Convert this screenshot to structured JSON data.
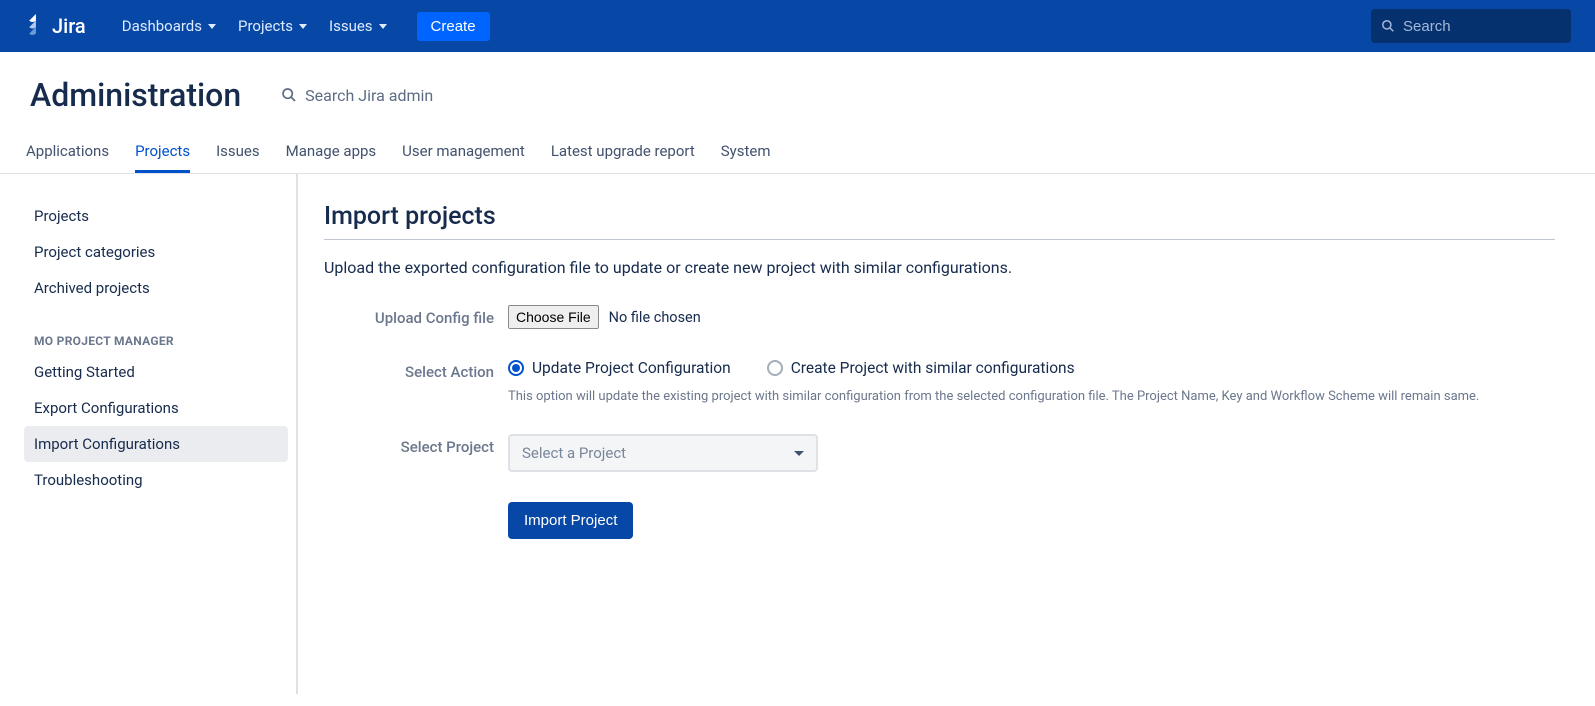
{
  "topnav": {
    "brand": "Jira",
    "items": [
      "Dashboards",
      "Projects",
      "Issues"
    ],
    "create_label": "Create",
    "search_placeholder": "Search"
  },
  "admin": {
    "title": "Administration",
    "search_placeholder": "Search Jira admin"
  },
  "tabs": [
    "Applications",
    "Projects",
    "Issues",
    "Manage apps",
    "User management",
    "Latest upgrade report",
    "System"
  ],
  "tabs_active_index": 1,
  "sidebar": {
    "group1": [
      "Projects",
      "Project categories",
      "Archived projects"
    ],
    "heading": "MO PROJECT MANAGER",
    "group2": [
      "Getting Started",
      "Export Configurations",
      "Import Configurations",
      "Troubleshooting"
    ],
    "group2_selected_index": 2
  },
  "main": {
    "title": "Import projects",
    "desc": "Upload the exported configuration file to update or create new project with similar configurations.",
    "upload_label": "Upload Config file",
    "choose_file_btn": "Choose File",
    "no_file": "No file chosen",
    "action_label": "Select Action",
    "radio1": "Update Project Configuration",
    "radio2": "Create Project with similar configurations",
    "help": "This option will update the existing project with similar configuration from the selected configuration file. The Project Name, Key and Workflow Scheme will remain same.",
    "select_project_label": "Select Project",
    "select_project_placeholder": "Select a Project",
    "import_btn": "Import Project"
  }
}
